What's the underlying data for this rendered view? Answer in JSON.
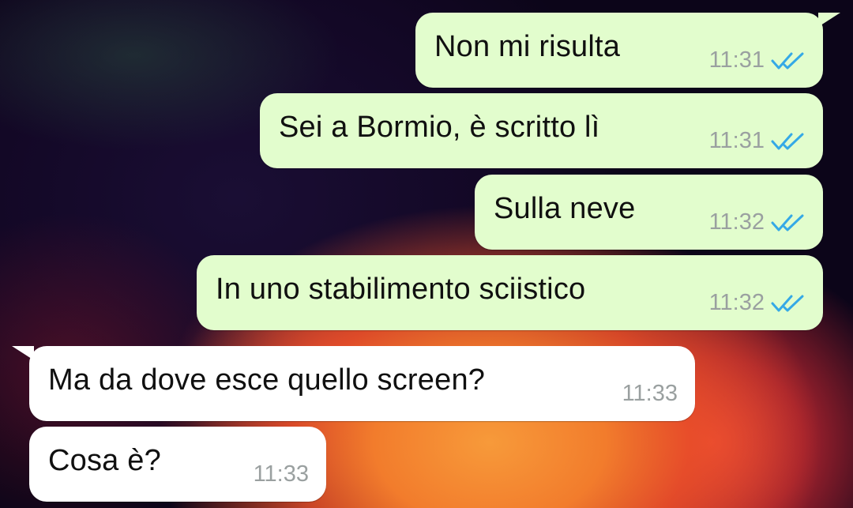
{
  "colors": {
    "outgoing_bubble": "#e2fdcd",
    "incoming_bubble": "#ffffff",
    "read_ticks": "#35a9e6",
    "timestamp": "#9aa0a0"
  },
  "messages": [
    {
      "direction": "outgoing",
      "text": "Non mi risulta",
      "time": "11:31",
      "status_icon": "double-check-read-icon"
    },
    {
      "direction": "outgoing",
      "text": "Sei a Bormio, è scritto lì",
      "time": "11:31",
      "status_icon": "double-check-read-icon"
    },
    {
      "direction": "outgoing",
      "text": "Sulla neve",
      "time": "11:32",
      "status_icon": "double-check-read-icon"
    },
    {
      "direction": "outgoing",
      "text": "In uno stabilimento sciistico",
      "time": "11:32",
      "status_icon": "double-check-read-icon"
    },
    {
      "direction": "incoming",
      "text": "Ma da dove esce quello screen?",
      "time": "11:33"
    },
    {
      "direction": "incoming",
      "text": "Cosa è?",
      "time": "11:33"
    }
  ]
}
